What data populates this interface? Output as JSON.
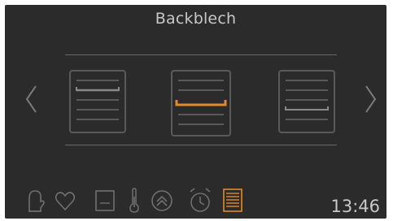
{
  "header": {
    "title": "Backblech"
  },
  "navigation": {
    "prev_icon": "chevron-left-icon",
    "next_icon": "chevron-right-icon"
  },
  "racks": [
    {
      "icon": "oven-rack-icon",
      "selected_level": 2,
      "levels": 5,
      "state": "inactive"
    },
    {
      "icon": "oven-rack-icon",
      "selected_level": 3,
      "levels": 5,
      "state": "selected"
    },
    {
      "icon": "oven-rack-icon",
      "selected_level": 4,
      "levels": 5,
      "state": "inactive"
    }
  ],
  "toolbar": {
    "icons": [
      {
        "name": "oven-mitt-icon",
        "active": false
      },
      {
        "name": "heart-icon",
        "active": false
      },
      {
        "name": "square-window-icon",
        "active": false
      },
      {
        "name": "thermometer-icon",
        "active": false
      },
      {
        "name": "rotate-arrows-icon",
        "active": false
      },
      {
        "name": "alarm-clock-icon",
        "active": false
      },
      {
        "name": "baking-tray-icon",
        "active": true
      }
    ]
  },
  "status": {
    "time": "13:46"
  },
  "colors": {
    "background": "#2b2b2b",
    "text": "#c8c8c8",
    "icon": "#6f6f6f",
    "accent": "#e08a2a"
  }
}
